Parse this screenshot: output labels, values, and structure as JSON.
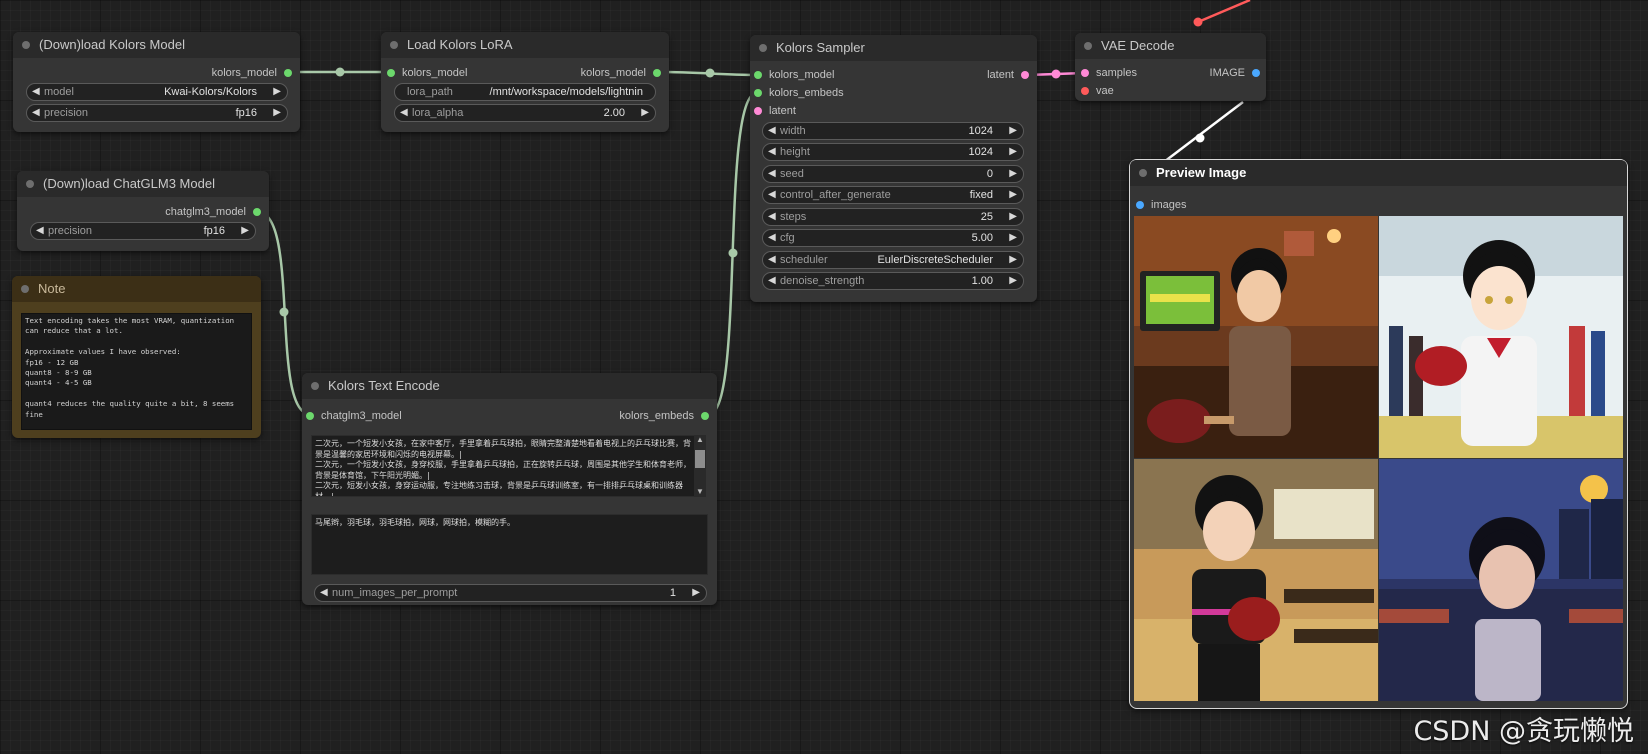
{
  "nodes": {
    "download_kolors": {
      "title": "(Down)load Kolors Model",
      "output_label": "kolors_model",
      "model_label": "model",
      "model_value": "Kwai-Kolors/Kolors",
      "precision_label": "precision",
      "precision_value": "fp16"
    },
    "download_chatglm": {
      "title": "(Down)load ChatGLM3 Model",
      "output_label": "chatglm3_model",
      "precision_label": "precision",
      "precision_value": "fp16"
    },
    "note": {
      "title": "Note",
      "text": "Text encoding takes the most VRAM, quantization\ncan reduce that a lot.\n\nApproximate values I have observed:\nfp16 - 12 GB\nquant8 - 8-9 GB\nquant4 - 4-5 GB\n\nquant4 reduces the quality quite a bit, 8 seems\nfine"
    },
    "lora": {
      "title": "Load Kolors LoRA",
      "input_label": "kolors_model",
      "output_label": "kolors_model",
      "lora_path_label": "lora_path",
      "lora_path_value": "/mnt/workspace/models/lightnin",
      "lora_alpha_label": "lora_alpha",
      "lora_alpha_value": "2.00"
    },
    "text_encode": {
      "title": "Kolors Text Encode",
      "input_label": "chatglm3_model",
      "output_label": "kolors_embeds",
      "prompt": "二次元，一个短发小女孩，在家中客厅，手里拿着乒乓球拍，眼睛完整清楚地看着电视上的乒乓球比赛，背景是温馨的家居环境和闪烁的电视屏幕。|\n二次元，一个短发小女孩，身穿校服，手里拿着乒乓球拍，正在旋转乒乓球，周围是其他学生和体育老师，背景是体育馆，下午阳光明媚。|\n二次元，短发小女孩，身穿运动服，专注地练习击球，背景是乒乓球训练室，有一排排乒乓球桌和训练器材。|",
      "negative_prompt": "马尾辫，羽毛球，羽毛球拍，网球，网球拍，模糊的手。",
      "num_images_label": "num_images_per_prompt",
      "num_images_value": "1"
    },
    "sampler": {
      "title": "Kolors Sampler",
      "inputs": [
        "kolors_model",
        "kolors_embeds",
        "latent"
      ],
      "output_label": "latent",
      "widgets": [
        {
          "label": "width",
          "value": "1024"
        },
        {
          "label": "height",
          "value": "1024"
        },
        {
          "label": "seed",
          "value": "0"
        },
        {
          "label": "control_after_generate",
          "value": "fixed"
        },
        {
          "label": "steps",
          "value": "25"
        },
        {
          "label": "cfg",
          "value": "5.00"
        },
        {
          "label": "scheduler",
          "value": "EulerDiscreteScheduler"
        },
        {
          "label": "denoise_strength",
          "value": "1.00"
        }
      ]
    },
    "vae_decode": {
      "title": "VAE Decode",
      "inputs": [
        "samples",
        "vae"
      ],
      "output_label": "IMAGE"
    },
    "preview": {
      "title": "Preview Image",
      "input_label": "images"
    }
  },
  "watermark": "CSDN @贪玩懒悦",
  "colors": {
    "canvas_bg": "#202020",
    "node_bg": "#353535",
    "link_default": "#a8c8a8",
    "link_latent": "#ff8ad6",
    "link_vae": "#ff5a5a",
    "link_image": "#ffffff"
  }
}
